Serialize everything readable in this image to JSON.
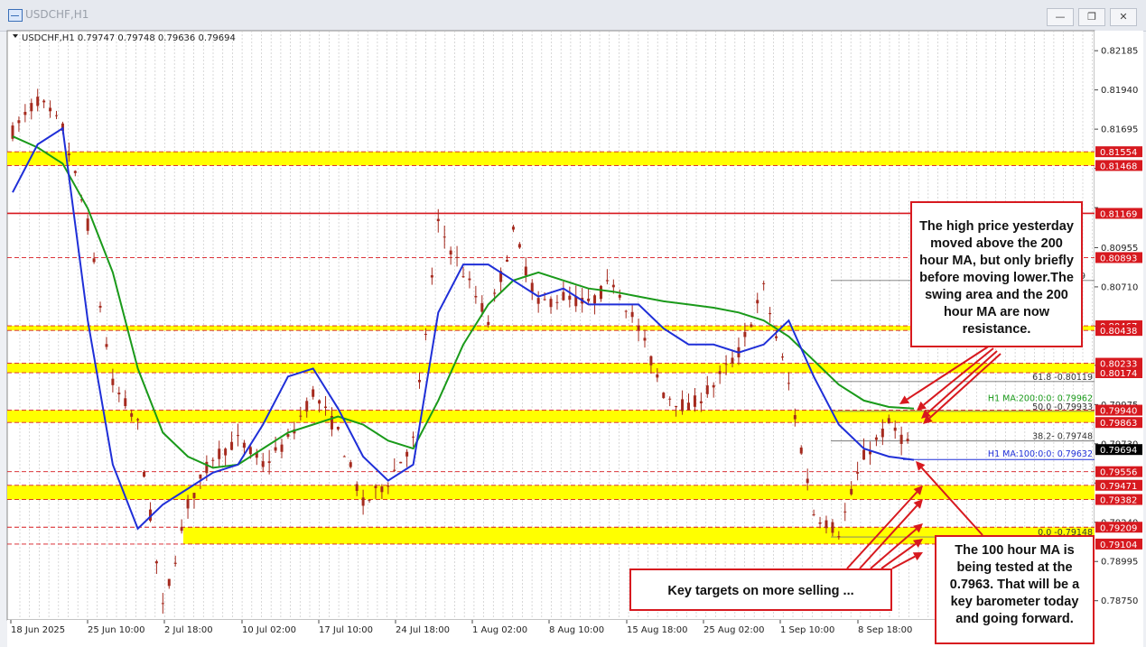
{
  "window": {
    "title": "USDCHF,H1",
    "icons": [
      "chart-window-icon",
      "minimize-icon",
      "restore-icon",
      "close-icon"
    ]
  },
  "header": {
    "symbol": "USDCHF,H1",
    "ohlc": "0.79747 0.79748 0.79636 0.79694"
  },
  "colors": {
    "zone": "#ffff00",
    "resistance": "#d7191f",
    "ma100": "#1f2fd8",
    "ma200": "#1a9a1a",
    "candle": "#a52a1e",
    "current_price_tag": "#000000"
  },
  "chart_data": {
    "type": "candlestick",
    "symbol": "USDCHF",
    "timeframe": "H1",
    "x_labels": [
      "18 Jun 2025",
      "25 Jun 10:00",
      "2 Jul 18:00",
      "10 Jul 02:00",
      "17 Jul 10:00",
      "24 Jul 18:00",
      "1 Aug 02:00",
      "8 Aug 10:00",
      "15 Aug 18:00",
      "25 Aug 02:00",
      "1 Sep 10:00",
      "8 Sep 18:00"
    ],
    "y_ticks": [
      0.82185,
      0.8194,
      0.81695,
      0.8145,
      0.81205,
      0.80955,
      0.8071,
      0.80465,
      0.8022,
      0.79975,
      0.7973,
      0.79485,
      0.7924,
      0.78995,
      0.7875
    ],
    "y_tick_labels": [
      "0.82185",
      "0.81940",
      "0.81695",
      "",
      "",
      "0.80955",
      "0.80710",
      "",
      "",
      "0.79975",
      "0.79730",
      "",
      "0.79240",
      "0.78995",
      "0.78750"
    ],
    "ylim": [
      0.7863,
      0.8231
    ],
    "x_sample_dates": [
      "18 Jun",
      "20 Jun",
      "22 Jun",
      "25 Jun",
      "28 Jun",
      "30 Jun",
      "2 Jul",
      "5 Jul",
      "7 Jul",
      "10 Jul",
      "12 Jul",
      "14 Jul",
      "17 Jul",
      "19 Jul",
      "21 Jul",
      "24 Jul",
      "27 Jul",
      "29 Jul",
      "1 Aug",
      "4 Aug",
      "6 Aug",
      "8 Aug",
      "11 Aug",
      "13 Aug",
      "15 Aug",
      "18 Aug",
      "20 Aug",
      "22 Aug",
      "25 Aug",
      "28 Aug",
      "30 Aug",
      "1 Sep",
      "4 Sep",
      "6 Sep",
      "8 Sep",
      "10 Sep",
      "11 Sep"
    ],
    "price_path": [
      0.8168,
      0.8188,
      0.817,
      0.811,
      0.801,
      0.7985,
      0.787,
      0.7935,
      0.7965,
      0.7975,
      0.796,
      0.7975,
      0.8005,
      0.798,
      0.7935,
      0.795,
      0.7975,
      0.811,
      0.808,
      0.805,
      0.8105,
      0.806,
      0.8065,
      0.806,
      0.8075,
      0.8045,
      0.8005,
      0.7995,
      0.801,
      0.803,
      0.807,
      0.801,
      0.793,
      0.7918,
      0.7965,
      0.7985,
      0.7969
    ],
    "ma100_path": [
      0.813,
      0.816,
      0.817,
      0.805,
      0.796,
      0.792,
      0.7935,
      0.7945,
      0.7955,
      0.796,
      0.7985,
      0.8015,
      0.802,
      0.7995,
      0.7965,
      0.795,
      0.796,
      0.8055,
      0.8085,
      0.8085,
      0.8075,
      0.8065,
      0.807,
      0.806,
      0.806,
      0.806,
      0.8045,
      0.8035,
      0.8035,
      0.803,
      0.8035,
      0.805,
      0.8015,
      0.7985,
      0.797,
      0.7965,
      0.7963
    ],
    "ma200_path": [
      0.8165,
      0.8158,
      0.8148,
      0.812,
      0.808,
      0.802,
      0.798,
      0.7965,
      0.7958,
      0.796,
      0.797,
      0.798,
      0.7985,
      0.799,
      0.7985,
      0.7975,
      0.797,
      0.8,
      0.8035,
      0.806,
      0.8075,
      0.808,
      0.8075,
      0.807,
      0.8068,
      0.8065,
      0.8062,
      0.806,
      0.8058,
      0.8055,
      0.805,
      0.804,
      0.8025,
      0.801,
      0.8,
      0.7996,
      0.7995
    ],
    "zones": [
      {
        "high": 0.81554,
        "low": 0.81468,
        "high_label": "0.81554",
        "low_label": "0.81468"
      },
      {
        "high": 0.80467,
        "low": 0.80438,
        "high_label": "0.80467",
        "low_label": "0.80438"
      },
      {
        "high": 0.80233,
        "low": 0.80174,
        "high_label": "0.80233",
        "low_label": "0.80174"
      },
      {
        "high": 0.7994,
        "low": 0.79863,
        "high_label": "0.79940",
        "low_label": "0.79863"
      },
      {
        "high": 0.79471,
        "low": 0.79382,
        "high_label": "0.79471",
        "low_label": "0.79382"
      },
      {
        "high": 0.79209,
        "low": 0.79104,
        "high_label": "0.79209",
        "low_label": "0.79104"
      }
    ],
    "resistance_lines": [
      {
        "price": 0.81169,
        "label": "0.81169",
        "style": "solid"
      },
      {
        "price": 0.80893,
        "label": "0.80893",
        "style": "dashed"
      },
      {
        "price": 0.79556,
        "label": "0.79556",
        "style": "dashed"
      }
    ],
    "fib_levels": [
      {
        "price": 0.8075,
        "label": "19"
      },
      {
        "price": 0.80119,
        "label": "61.8 -0.80119"
      },
      {
        "price": 0.79933,
        "label": "50.0 -0.79933"
      },
      {
        "price": 0.79748,
        "label": "38.2- 0.79748"
      },
      {
        "price": 0.79148,
        "label": "0.0 -0.79148"
      }
    ],
    "ma_labels": [
      {
        "name": "H1 MA:200:0:0: 0.79962",
        "price": 0.79962
      },
      {
        "name": "H1 MA:100:0:0: 0.79632",
        "price": 0.79632
      }
    ],
    "current_price": 0.79694,
    "current_price_label": "0.79694"
  },
  "annotations": {
    "callout_high": "The high price yesterday moved above the 200 hour MA, but only briefly before moving lower.The swing area and the 200 hour MA are now resistance.",
    "callout_targets": "Key targets on more selling ...",
    "callout_100": "The 100 hour MA is being tested at the 0.7963. That will be a key barometer today and going forward."
  }
}
